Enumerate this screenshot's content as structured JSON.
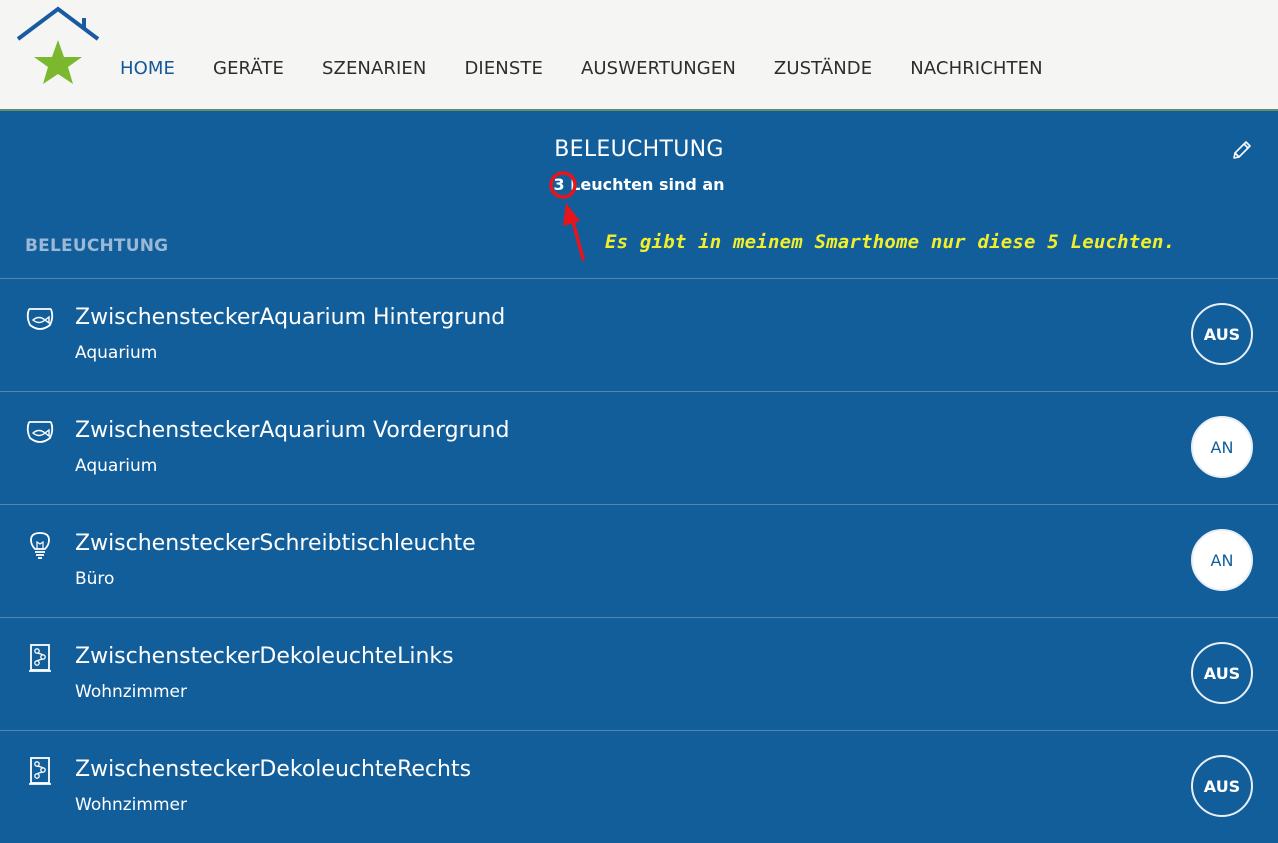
{
  "nav": {
    "items": [
      {
        "label": "HOME",
        "active": true
      },
      {
        "label": "GERÄTE",
        "active": false
      },
      {
        "label": "SZENARIEN",
        "active": false
      },
      {
        "label": "DIENSTE",
        "active": false
      },
      {
        "label": "AUSWERTUNGEN",
        "active": false
      },
      {
        "label": "ZUSTÄNDE",
        "active": false
      },
      {
        "label": "NACHRICHTEN",
        "active": false
      }
    ]
  },
  "panel": {
    "title": "BELEUCHTUNG",
    "count": "3",
    "subtitle_rest": " Leuchten sind an",
    "section_label": "BELEUCHTUNG"
  },
  "annotation": {
    "text": "Es gibt in meinem Smarthome nur diese 5 Leuchten.",
    "color": "#f2ef2a",
    "marker_color": "#e8141c"
  },
  "devices": [
    {
      "name": "ZwischensteckerAquarium Hintergrund",
      "room": "Aquarium",
      "icon": "fishbowl-icon",
      "state": "AUS",
      "on": false
    },
    {
      "name": "ZwischensteckerAquarium Vordergrund",
      "room": "Aquarium",
      "icon": "fishbowl-icon",
      "state": "AN",
      "on": true
    },
    {
      "name": "ZwischensteckerSchreibtischleuchte",
      "room": "Büro",
      "icon": "lightbulb-icon",
      "state": "AN",
      "on": true
    },
    {
      "name": "ZwischensteckerDekoleuchteLinks",
      "room": "Wohnzimmer",
      "icon": "deko-lamp-icon",
      "state": "AUS",
      "on": false
    },
    {
      "name": "ZwischensteckerDekoleuchteRechts",
      "room": "Wohnzimmer",
      "icon": "deko-lamp-icon",
      "state": "AUS",
      "on": false
    }
  ],
  "colors": {
    "brand_blue": "#125e9a",
    "logo_star": "#7cb82f",
    "logo_roof": "#1a5aa0"
  }
}
